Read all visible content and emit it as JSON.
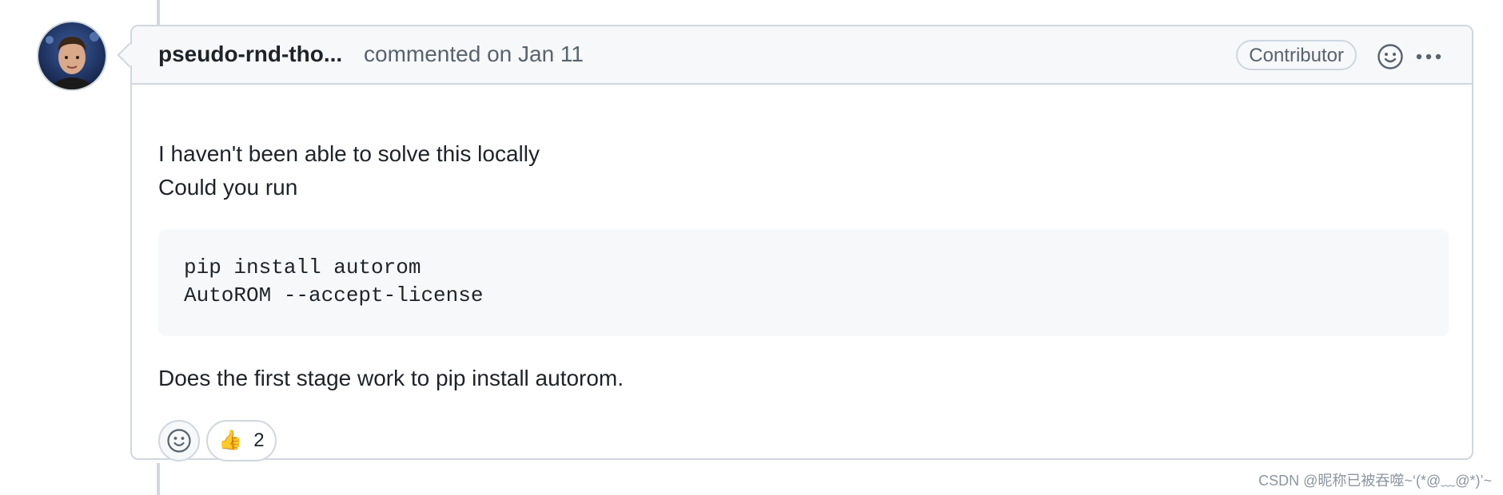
{
  "comment": {
    "author": "pseudo-rnd-tho...",
    "meta": "commented on Jan 11",
    "role_badge": "Contributor",
    "body": {
      "line1": "I haven't been able to solve this locally",
      "line2": "Could you run",
      "code_lines": [
        "pip install autorom",
        "AutoROM --accept-license"
      ],
      "line3": "Does the first stage work to pip install autorom."
    },
    "reactions": [
      {
        "icon": "thumbs-up-icon",
        "glyph": "👍",
        "count": "2"
      }
    ]
  },
  "icons": {
    "avatar": "avatar",
    "header_emoji": "smiley-icon",
    "header_more": "kebab-horizontal-icon",
    "add_reaction": "smiley-icon"
  },
  "watermark": "CSDN @昵称已被吞噬~‘(*@﹏@*)’~",
  "colors": {
    "border": "#d0d7de",
    "header_bg": "#f6f8fa",
    "muted_text": "#59636e",
    "text": "#1f2328"
  }
}
